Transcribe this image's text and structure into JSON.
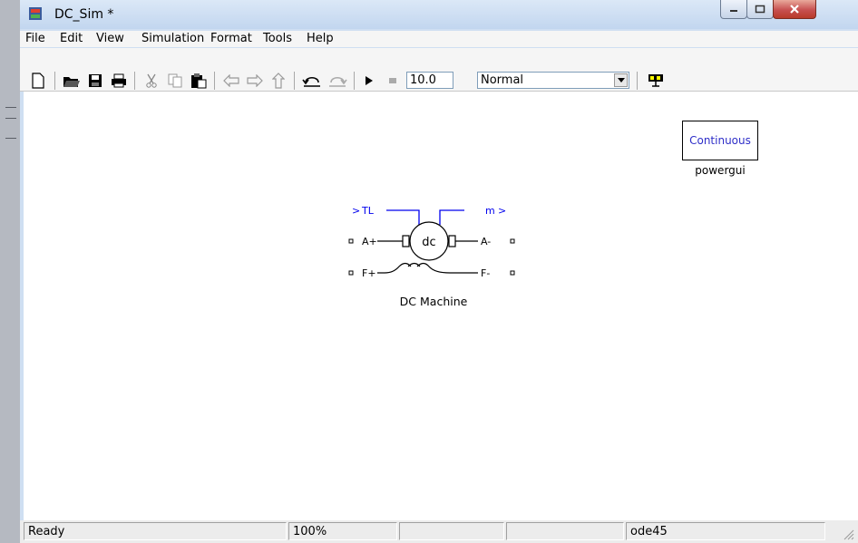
{
  "window": {
    "title": "DC_Sim *"
  },
  "menu": [
    "File",
    "Edit",
    "View",
    "Simulation",
    "Format",
    "Tools",
    "Help"
  ],
  "toolbar": {
    "icons": [
      "new-icon",
      "open-icon",
      "save-icon",
      "print-icon",
      "cut-icon",
      "copy-icon",
      "paste-icon",
      "back-icon",
      "forward-icon",
      "up-icon",
      "undo-icon",
      "redo-icon",
      "start-icon",
      "stop-icon",
      "build-icon"
    ],
    "stop_time": "10.0",
    "sim_mode": "Normal"
  },
  "canvas": {
    "powergui": {
      "inner_label": "Continuous",
      "caption": "powergui"
    },
    "dc_machine": {
      "caption": "DC Machine",
      "symbol": "dc",
      "port_tl": "TL",
      "port_m": "m",
      "port_a_plus": "A+",
      "port_a_minus": "A-",
      "port_f_plus": "F+",
      "port_f_minus": "F-"
    }
  },
  "status": {
    "state": "Ready",
    "zoom": "100%",
    "solver": "ode45"
  },
  "colors": {
    "port_blue": "#0000ee",
    "titlebar": "#c2d6ef"
  }
}
